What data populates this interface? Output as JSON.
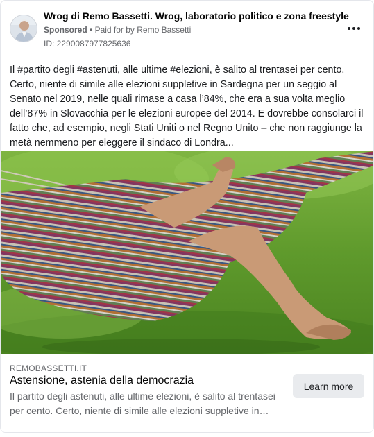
{
  "header": {
    "page_name": "Wrog di Remo Bassetti. Wrog, laboratorio politico e zona freestyle",
    "sponsored": "Sponsored",
    "separator": "•",
    "paid_for": "Paid for by Remo Bassetti",
    "ad_id": "ID: 2290087977825636",
    "more_icon": "ellipsis-icon"
  },
  "post": {
    "text": "Il #partito degli #astenuti, alle ultime #elezioni, è salito al trentasei per cento. Certo, niente di simile alle elezioni suppletive in Sardegna per un seggio al Senato nel 2019, nelle quali rimase a casa l’84%, che era a sua volta meglio dell’87% in Slovacchia per le elezioni europee del 2014. E dovrebbe consolarci il fatto che, ad esempio, negli Stati Uniti o nel Regno Unito – che non raggiunge la metà nemmeno per eleggere il sindaco di Londra..."
  },
  "link": {
    "domain": "REMOBASSETTI.IT",
    "headline": "Astensione, astenia della democrazia",
    "description": "Il partito degli astenuti, alle ultime elezioni, è salito al trentasei per cento. Certo, niente di simile alle elezioni suppletive in…",
    "cta_label": "Learn more"
  },
  "colors": {
    "secondary_text": "#65676b",
    "cta_background": "#e9ebee",
    "grass": "#5f9a2c"
  }
}
